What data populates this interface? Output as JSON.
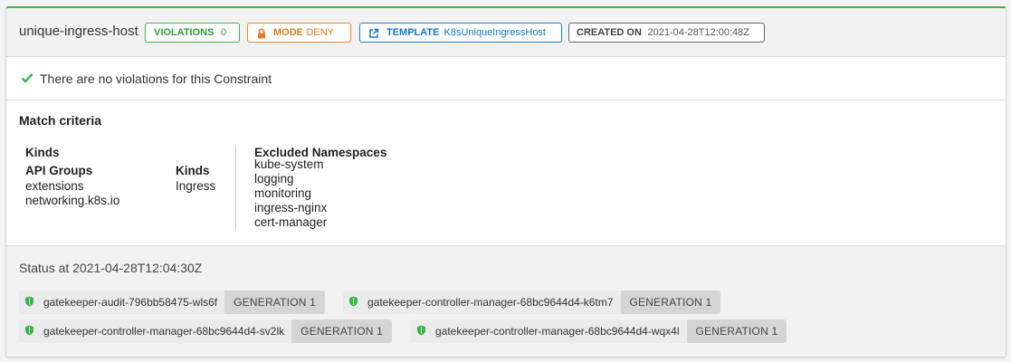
{
  "constraint": {
    "name": "unique-ingress-host",
    "violations_label": "VIOLATIONS",
    "violations_count": "0",
    "mode_label": "MODE",
    "mode_value": "DENY",
    "template_label": "TEMPLATE",
    "template_value": "K8sUniqueIngressHost",
    "created_label": "CREATED ON",
    "created_value": "2021-04-28T12:00:48Z"
  },
  "no_violations_text": "There are no violations for this Constraint",
  "match": {
    "title": "Match criteria",
    "kinds_heading": "Kinds",
    "api_groups_heading": "API Groups",
    "api_groups": [
      "extensions",
      "networking.k8s.io"
    ],
    "kinds_sub_heading": "Kinds",
    "kinds": [
      "Ingress"
    ],
    "excluded_heading": "Excluded Namespaces",
    "excluded_namespaces": [
      "kube-system",
      "logging",
      "monitoring",
      "ingress-nginx",
      "cert-manager"
    ]
  },
  "status": {
    "title": "Status at 2021-04-28T12:04:30Z",
    "pods": [
      {
        "name": "gatekeeper-audit-796bb58475-wls6f",
        "generation": "GENERATION 1"
      },
      {
        "name": "gatekeeper-controller-manager-68bc9644d4-k6tm7",
        "generation": "GENERATION 1"
      },
      {
        "name": "gatekeeper-controller-manager-68bc9644d4-sv2lk",
        "generation": "GENERATION 1"
      },
      {
        "name": "gatekeeper-controller-manager-68bc9644d4-wqx4l",
        "generation": "GENERATION 1"
      }
    ]
  },
  "colors": {
    "success": "#3cb34a",
    "warning": "#e8882c",
    "info": "#1b7fd0"
  },
  "icons": {
    "mode": "lock-icon",
    "template": "external-link-icon",
    "no_violations": "check-icon",
    "pod": "shield-icon"
  }
}
